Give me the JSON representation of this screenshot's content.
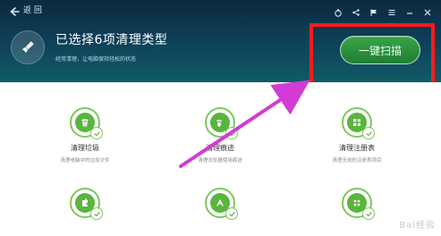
{
  "topbar": {
    "back_label": "返 回"
  },
  "header": {
    "title": "已选择6项清理类型",
    "subtitle": "经常清理，让电脑保持轻松的状态",
    "scan_button_label": "一键扫描"
  },
  "items": [
    {
      "title": "清理垃圾",
      "desc": "清理电脑中的垃圾文件",
      "icon": "trash-icon"
    },
    {
      "title": "清理痕迹",
      "desc": "清理浏览器使用痕迹",
      "icon": "footprint-icon"
    },
    {
      "title": "清理注册表",
      "desc": "清理无效的注册表项目",
      "icon": "registry-icon"
    },
    {
      "title": "",
      "desc": "",
      "icon": "plugin-icon"
    },
    {
      "title": "",
      "desc": "",
      "icon": "tools-icon"
    },
    {
      "title": "",
      "desc": "",
      "icon": "grid-icon"
    }
  ],
  "watermark": {
    "text": "Bai经验"
  },
  "colors": {
    "accent_green": "#5ab43e",
    "highlight_red": "#ff1b1b",
    "arrow_magenta": "#d23bd6",
    "header_dark": "#0e3d57"
  }
}
